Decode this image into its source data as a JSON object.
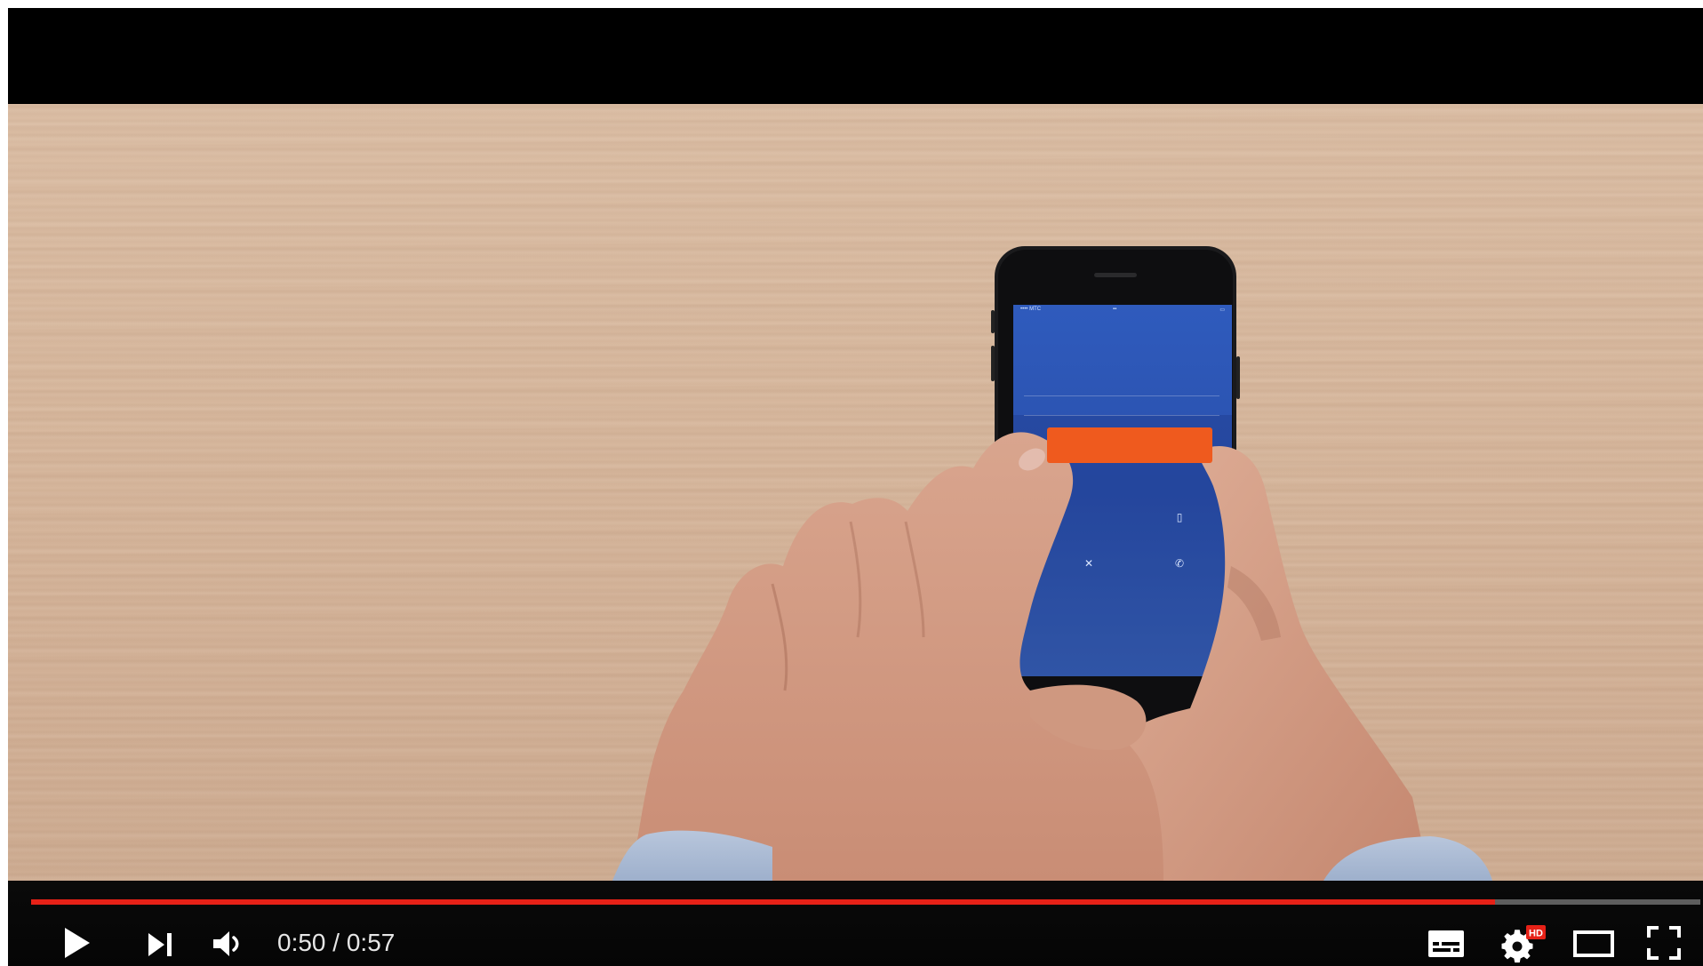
{
  "video": {
    "accent_color": "#e62117",
    "progress_fraction": 0.877
  },
  "controls": {
    "current_time": "0:50",
    "separator": " / ",
    "duration": "0:57",
    "icons": [
      "play-icon",
      "next-icon",
      "volume-icon",
      "subtitles-icon",
      "settings-icon",
      "theater-mode-icon",
      "fullscreen-icon"
    ],
    "settings_badge": "HD"
  }
}
